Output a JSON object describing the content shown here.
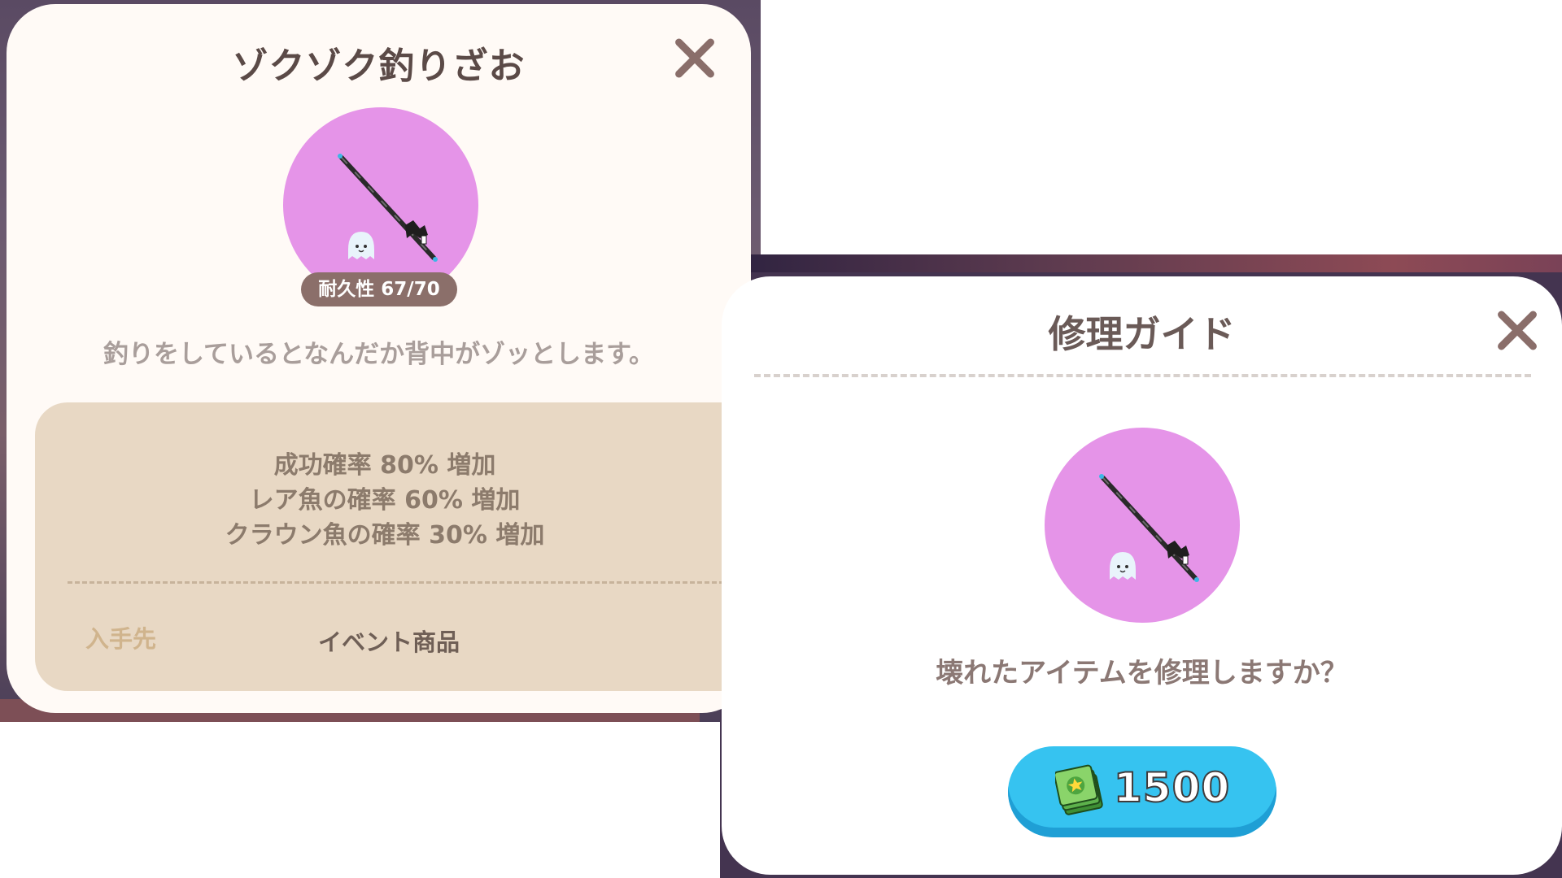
{
  "item_panel": {
    "title": "ゾクゾク釣りざお",
    "item_icon": "fishing-rod-with-ghost",
    "durability": "耐久性 67/70",
    "description": "釣りをしているとなんだか背中がゾッとします。",
    "stats": [
      "成功確率 80% 増加",
      "レア魚の確率 60% 増加",
      "クラウン魚の確率 30% 増加"
    ],
    "source_label": "入手先",
    "source_value": "イベント商品",
    "close_icon": "close-icon"
  },
  "repair_panel": {
    "title": "修理ガイド",
    "item_icon": "fishing-rod-with-ghost",
    "question": "壊れたアイテムを修理しますか？",
    "cost": "1500",
    "cost_icon": "cash-stack-icon",
    "close_icon": "close-icon"
  },
  "colors": {
    "item_circle": "#e594e8",
    "cost_button": "#36c3f0",
    "stats_box": "#e8d8c4"
  }
}
